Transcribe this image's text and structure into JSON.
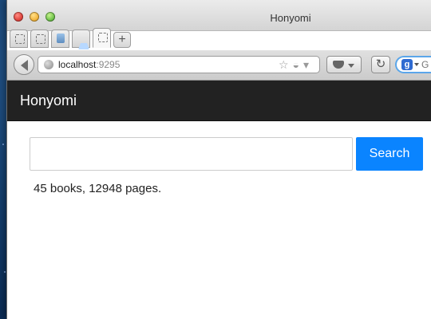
{
  "browser": {
    "window_title": "Honyomi",
    "address": {
      "host": "localhost",
      "port": ":9295"
    },
    "search_placeholder": "G"
  },
  "app": {
    "brand": "Honyomi",
    "search": {
      "input_value": "",
      "button_label": "Search"
    },
    "stats": "45 books, 12948 pages."
  }
}
